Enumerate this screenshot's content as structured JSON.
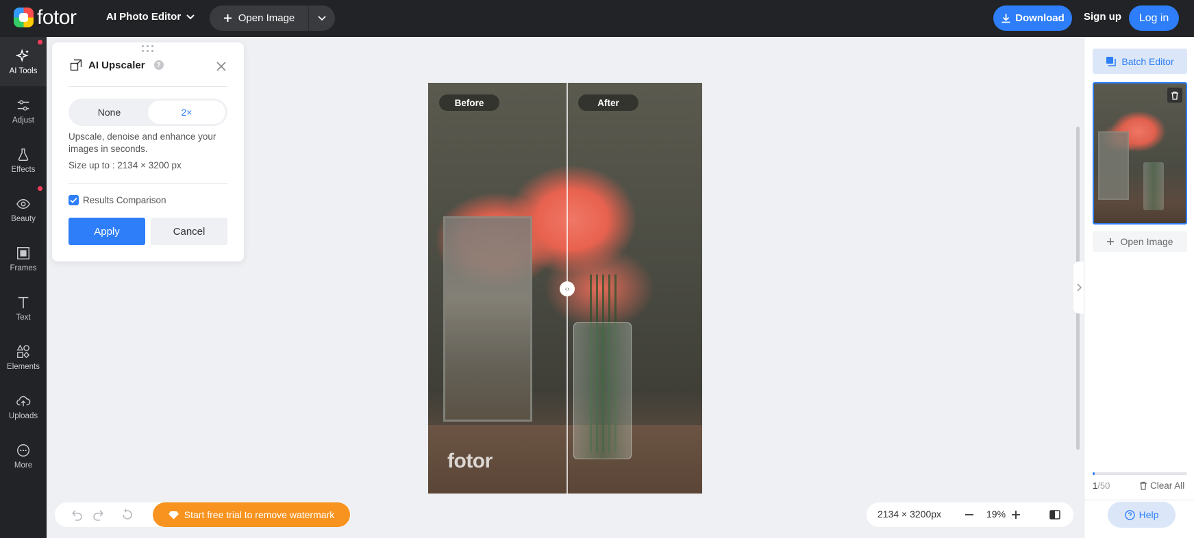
{
  "header": {
    "logo_text": "fotor",
    "editor_menu": "AI Photo Editor",
    "open_image": "Open Image",
    "download": "Download",
    "sign_up": "Sign up",
    "log_in": "Log in"
  },
  "sidebar": {
    "items": [
      {
        "label": "AI Tools",
        "icon": "sparkle-icon",
        "active": true,
        "dot": true
      },
      {
        "label": "Adjust",
        "icon": "sliders-icon"
      },
      {
        "label": "Effects",
        "icon": "flask-icon"
      },
      {
        "label": "Beauty",
        "icon": "eye-icon",
        "dot": true
      },
      {
        "label": "Frames",
        "icon": "frame-icon"
      },
      {
        "label": "Text",
        "icon": "text-icon"
      },
      {
        "label": "Elements",
        "icon": "shapes-icon"
      },
      {
        "label": "Uploads",
        "icon": "upload-cloud-icon"
      },
      {
        "label": "More",
        "icon": "more-icon"
      }
    ]
  },
  "upscaler": {
    "title": "AI Upscaler",
    "options": [
      "None",
      "2×"
    ],
    "selected_option": "2×",
    "description": "Upscale, denoise and enhance your images in seconds.",
    "size_text": "Size up to : 2134 × 3200 px",
    "results_comparison_label": "Results Comparison",
    "results_comparison_checked": true,
    "apply": "Apply",
    "cancel": "Cancel"
  },
  "canvas": {
    "before_label": "Before",
    "after_label": "After",
    "watermark": "fotor"
  },
  "bottom_bar": {
    "promo": "Start free trial to remove watermark",
    "dimensions": "2134 × 3200px",
    "zoom": "19%"
  },
  "right_panel": {
    "batch_editor": "Batch Editor",
    "open_image": "Open Image",
    "count_current": "1",
    "count_total": "/50",
    "progress_fraction": 0.02,
    "clear_all": "Clear All",
    "help": "Help"
  },
  "colors": {
    "accent": "#2d7ef8",
    "topbar": "#222326",
    "promo": "#f7931e",
    "notification_dot": "#ff3b5c"
  }
}
